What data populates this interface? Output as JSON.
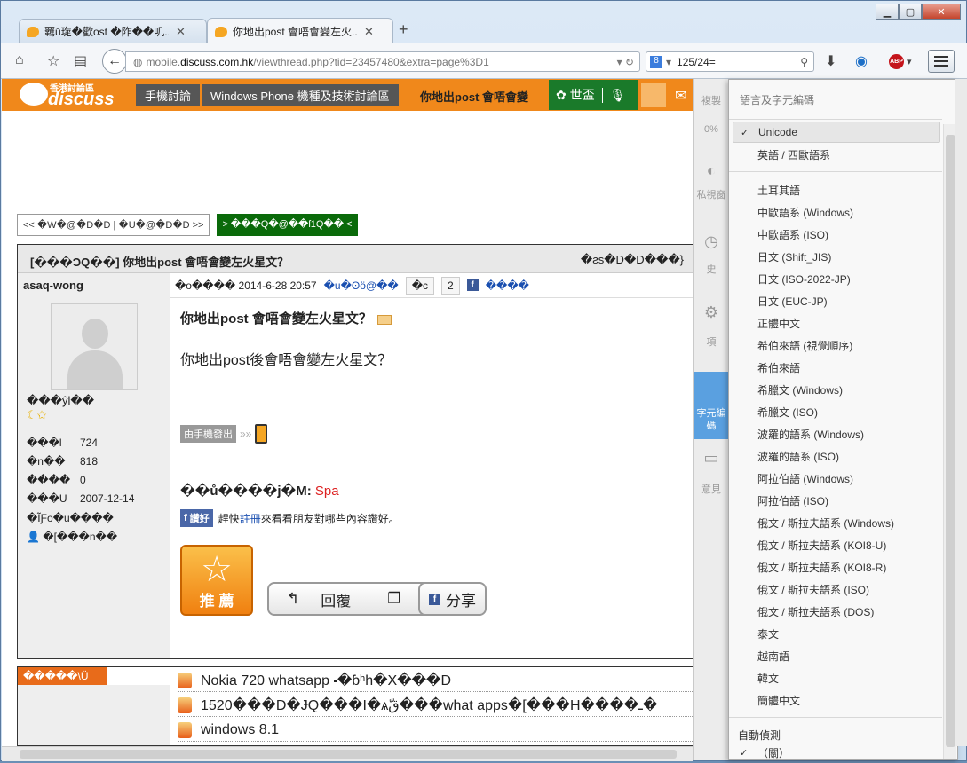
{
  "browser": {
    "tabs": [
      {
        "label": "覊ū琁�歡ost �阼��叽..."
      },
      {
        "label": "你地出post 會唔會變左火..."
      }
    ],
    "new_tab": "+",
    "url_prefix": "mobile.",
    "url_domain": "discuss.com.hk",
    "url_path": "/viewthread.php?tid=23457480&extra=page%3D1",
    "search_value": "125/24=",
    "abp": "ABP"
  },
  "site": {
    "logo_top": "香港討論區",
    "logo_main": "discuss",
    "crumb1": "手機討論",
    "crumb2": "Windows Phone 機種及技術討論區",
    "crumb_title": "你地出post 會唔會變",
    "world": "✿ 世盃",
    "pager_prev": "<< �W�@�D�D | �U�@�D�D >>",
    "pager_next": "> ���Q�@��ſ1Q�� <"
  },
  "thread": {
    "title": "[���ϽQ��] 你地出post 會唔會變左火星文？",
    "title_right": "�ƨs�D�D���} ",
    "author": "asaq-wong",
    "user_level": "���ŷl��",
    "stars": "☾✩",
    "stats": [
      {
        "k": "���l",
        "v": "724"
      },
      {
        "k": "�n��",
        "v": "818"
      },
      {
        "k": "����",
        "v": "0"
      },
      {
        "k": "���U",
        "v": "2007-12-14"
      }
    ],
    "link1": "�ĨƑo�u����",
    "link2": "�[���n��",
    "meta_posted": "�o���� 2014-6-28 20:57",
    "meta_blue": "�u�ʘö@��",
    "meta_box1": "�c",
    "meta_box2": "2",
    "meta_fb": "����",
    "post_title": "你地出post 會唔會變左火星文？",
    "post_text": "你地出post後會唔會變左火星文？",
    "mobile_badge": "由手機發出",
    "sig_label": "��ů����j�M:",
    "sig_link": "Spa",
    "like_btn": "讚好",
    "like_text_pre": "趕快",
    "like_link": "註冊",
    "like_text_post": "來看看朋友對哪些內容讚好。",
    "recommend": "推 薦",
    "reply": "回覆",
    "quote": "引用",
    "share": "分享"
  },
  "related": {
    "header": "�����\\Ü",
    "items": [
      {
        "label": "Nokia 720 whatsapp ⬝�ɓʰh�X���D"
      },
      {
        "label": "1520���D�ɈQ���I�ѧقّ���what apps�[���H����ـ�"
      },
      {
        "label": "windows 8.1"
      }
    ]
  },
  "sidepanel": {
    "items": [
      "複製",
      "0%",
      "私視窗",
      "史",
      "項",
      "字元編碼",
      "意見"
    ]
  },
  "dropdown": {
    "header": "語言及字元編碼",
    "selected": "Unicode",
    "group1": [
      "英語 / 西歐語系"
    ],
    "group2": [
      "土耳其語",
      "中歐語系 (Windows)",
      "中歐語系 (ISO)",
      "日文 (Shift_JIS)",
      "日文 (ISO-2022-JP)",
      "日文 (EUC-JP)",
      "正體中文",
      "希伯來語 (視覺順序)",
      "希伯來語",
      "希臘文 (Windows)",
      "希臘文 (ISO)",
      "波羅的語系 (Windows)",
      "波羅的語系 (ISO)",
      "阿拉伯語 (Windows)",
      "阿拉伯語 (ISO)",
      "俄文 / 斯拉夫語系 (Windows)",
      "俄文 / 斯拉夫語系 (KOI8-U)",
      "俄文 / 斯拉夫語系 (KOI8-R)",
      "俄文 / 斯拉夫語系 (ISO)",
      "俄文 / 斯拉夫語系 (DOS)",
      "泰文",
      "越南語",
      "韓文",
      "簡體中文"
    ],
    "autodetect_header": "自動偵測",
    "autodetect_value": "（關）"
  }
}
